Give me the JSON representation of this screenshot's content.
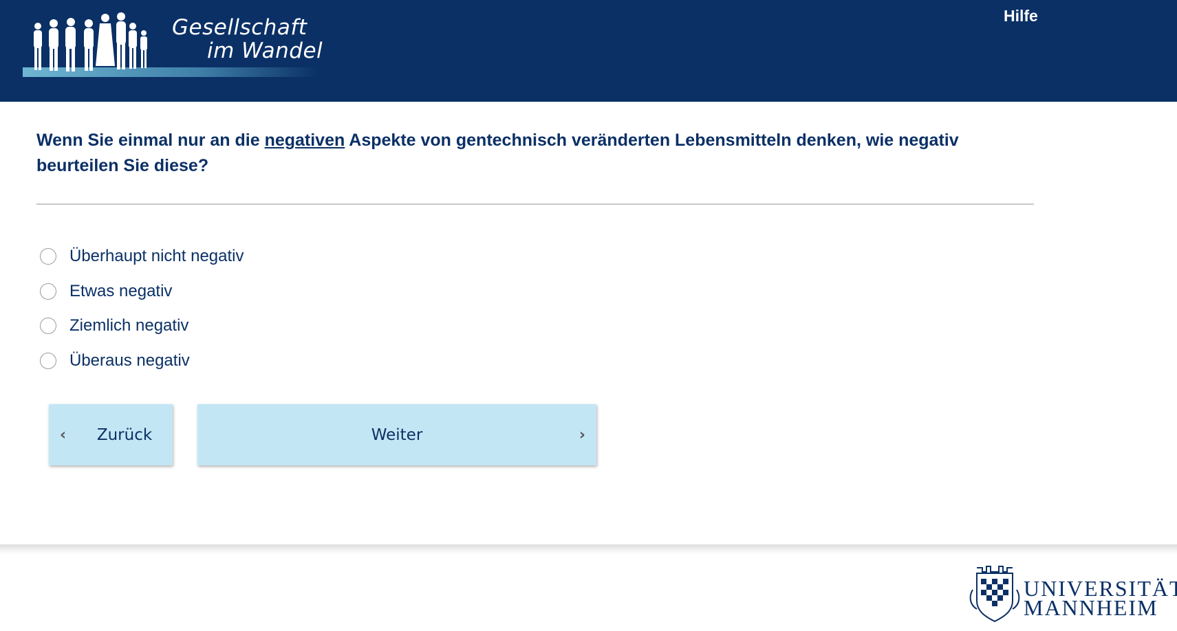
{
  "header": {
    "logo": {
      "line1": "Gesellschaft",
      "line2": "im Wandel"
    },
    "help_label": "Hilfe"
  },
  "question": {
    "prefix": "Wenn Sie einmal nur an die ",
    "emphasis": "negativen",
    "suffix": " Aspekte von gentechnisch veränderten Lebensmitteln denken, wie negativ beurteilen Sie diese?"
  },
  "options": [
    {
      "label": "Überhaupt nicht negativ",
      "selected": false
    },
    {
      "label": "Etwas negativ",
      "selected": false
    },
    {
      "label": "Ziemlich negativ",
      "selected": false
    },
    {
      "label": "Überaus negativ",
      "selected": false
    }
  ],
  "nav": {
    "back_label": "Zurück",
    "next_label": "Weiter",
    "back_icon": "chevron-left-icon",
    "next_icon": "chevron-right-icon"
  },
  "footer": {
    "university_line1": "UNIVERSITÄT",
    "university_line2": "MANNHEIM"
  },
  "colors": {
    "header_bg": "#0b3066",
    "text_primary": "#0b3066",
    "button_bg": "#c3e6f4"
  }
}
